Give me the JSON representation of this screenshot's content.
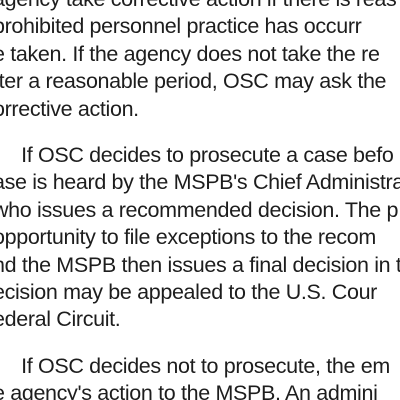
{
  "document": {
    "paragraphs": [
      {
        "lines": [
          "agency take corrective action if there is reas",
          "prohibited personnel practice has occurr",
          "e taken. If the agency does not take the re",
          "fter a reasonable period, OSC may ask the",
          "orrective action."
        ]
      },
      {
        "lines": [
          "     If OSC decides to prosecute a case befo",
          "ase is heard by the MSPB's Chief Administra",
          "who issues a recommended decision. The p",
          "opportunity to file exceptions to the recom",
          "nd the MSPB then issues a final decision in t",
          "ecision may be appealed to the U.S. Cour",
          "ederal Circuit."
        ]
      },
      {
        "lines": [
          "     If OSC decides not to prosecute, the em",
          "e agency's action to the MSPB. An admini"
        ]
      }
    ]
  }
}
